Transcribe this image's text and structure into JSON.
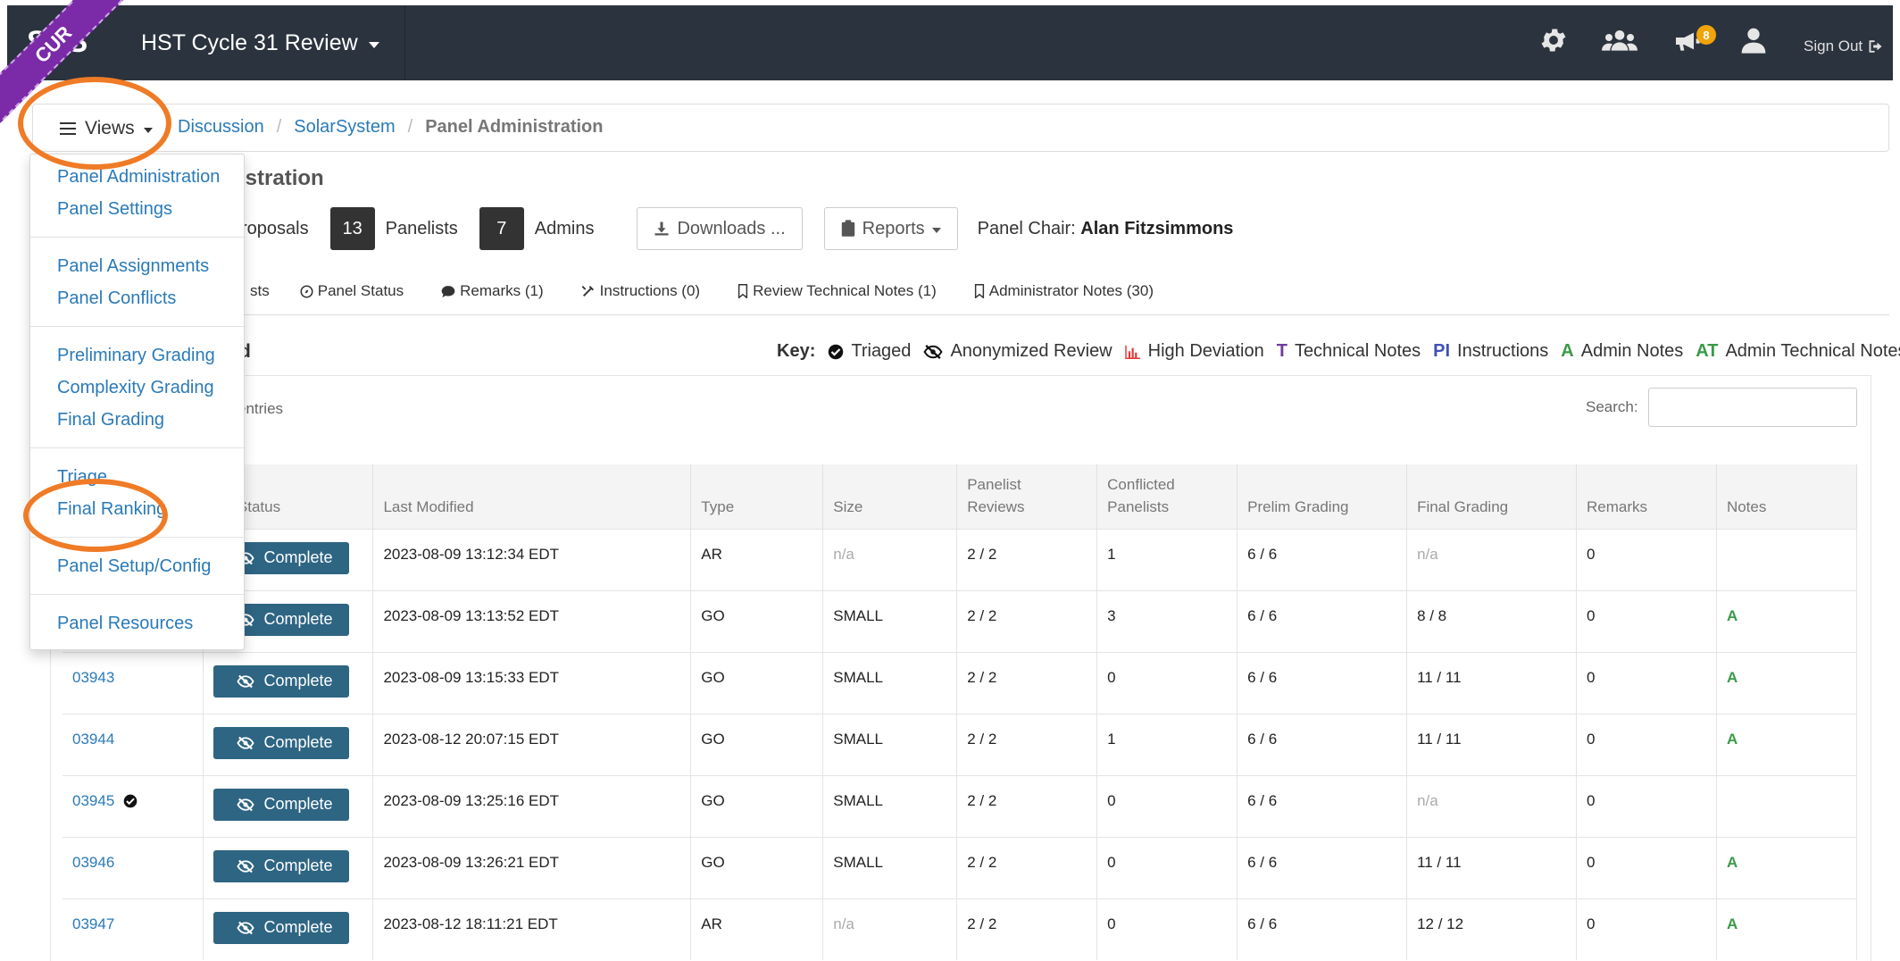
{
  "navbar": {
    "brand": "STS",
    "ribbon_text": "CUR",
    "app_title": "HST Cycle 31 Review",
    "icons": [
      "gear-icon",
      "users-icon",
      "megaphone-icon",
      "user-icon"
    ],
    "notification_count": "8",
    "sign_out_label": "Sign Out"
  },
  "breadcrumb": {
    "views_label": "Views",
    "items": [
      "Discussion",
      "SolarSystem"
    ],
    "current": "Panel Administration"
  },
  "header": {
    "title_fragment": "istration",
    "proposals_fragment": "roposals",
    "panelists_count": "13",
    "panelists_label": "Panelists",
    "admins_count": "7",
    "admins_label": "Admins",
    "downloads_label": "Downloads ...",
    "reports_label": "Reports",
    "chair_label": "Panel Chair:",
    "chair_name": "Alan Fitzsimmons"
  },
  "tabs": {
    "fragment": "sts",
    "panel_status": "Panel Status",
    "remarks": "Remarks (1)",
    "instructions": "Instructions (0)",
    "review_technical_notes": "Review Technical Notes (1)",
    "administrator_notes": "Administrator Notes (30)"
  },
  "section": {
    "title_fragment": "d",
    "entries_fragment": "entries",
    "search_label": "Search:"
  },
  "key": {
    "label": "Key:",
    "triaged": "Triaged",
    "anonymized": "Anonymized Review",
    "high_deviation": "High Deviation",
    "t_symbol": "T",
    "technical_notes": "Technical Notes",
    "pi_symbol": "PI",
    "instructions": "Instructions",
    "a_symbol": "A",
    "admin_notes": "Admin Notes",
    "at_symbol": "AT",
    "admin_technical_notes": "Admin Technical Notes"
  },
  "table": {
    "headers": {
      "review_status": "ew Status",
      "last_modified": "Last Modified",
      "type": "Type",
      "size": "Size",
      "panelist_reviews_1": "Panelist",
      "panelist_reviews_2": "Reviews",
      "conflicted_1": "Conflicted",
      "conflicted_2": "Panelists",
      "prelim": "Prelim Grading",
      "final": "Final Grading",
      "remarks": "Remarks",
      "notes": "Notes"
    },
    "rows": [
      {
        "id": "",
        "status": "Complete",
        "modified": "2023-08-09 13:12:34 EDT",
        "type": "AR",
        "size": "n/a",
        "reviews": "2  /  2",
        "conflicted": "1",
        "prelim": "6  /  6",
        "final": "n/a",
        "remarks": "0",
        "notes": ""
      },
      {
        "id": "",
        "status": "Complete",
        "modified": "2023-08-09 13:13:52 EDT",
        "type": "GO",
        "size": "SMALL",
        "reviews": "2  /  2",
        "conflicted": "3",
        "prelim": "6  /  6",
        "final": "8  /  8",
        "remarks": "0",
        "notes": "A"
      },
      {
        "id": "03943",
        "status": "Complete",
        "modified": "2023-08-09 13:15:33 EDT",
        "type": "GO",
        "size": "SMALL",
        "reviews": "2  /  2",
        "conflicted": "0",
        "prelim": "6  /  6",
        "final": "11  /  11",
        "remarks": "0",
        "notes": "A"
      },
      {
        "id": "03944",
        "status": "Complete",
        "modified": "2023-08-12 20:07:15 EDT",
        "type": "GO",
        "size": "SMALL",
        "reviews": "2  /  2",
        "conflicted": "1",
        "prelim": "6  /  6",
        "final": "11  /  11",
        "remarks": "0",
        "notes": "A"
      },
      {
        "id": "03945",
        "status": "Complete",
        "modified": "2023-08-09 13:25:16 EDT",
        "type": "GO",
        "size": "SMALL",
        "reviews": "2  /  2",
        "conflicted": "0",
        "prelim": "6  /  6",
        "final": "n/a",
        "remarks": "0",
        "notes": ""
      },
      {
        "id": "03946",
        "status": "Complete",
        "modified": "2023-08-09 13:26:21 EDT",
        "type": "GO",
        "size": "SMALL",
        "reviews": "2  /  2",
        "conflicted": "0",
        "prelim": "6  /  6",
        "final": "11  /  11",
        "remarks": "0",
        "notes": "A"
      },
      {
        "id": "03947",
        "status": "Complete",
        "modified": "2023-08-12 18:11:21 EDT",
        "type": "AR",
        "size": "n/a",
        "reviews": "2  /  2",
        "conflicted": "0",
        "prelim": "6  /  6",
        "final": "12  /  12",
        "remarks": "0",
        "notes": "A"
      }
    ]
  },
  "views_menu": {
    "items": [
      "Panel Administration",
      "Panel Settings",
      "Panel Assignments",
      "Panel Conflicts",
      "Preliminary Grading",
      "Complexity Grading",
      "Final Grading",
      "Triage",
      "Final Ranking",
      "Panel Setup/Config",
      "Panel Resources"
    ]
  },
  "colors": {
    "navbar_bg": "#2b333e",
    "ribbon": "#7b2aa8",
    "link": "#2a7ab8",
    "complete_button": "#2e6583",
    "highlight": "#f07b26",
    "admin_notes": "#3a9a48",
    "technical_notes": "#6f3ba1",
    "instructions": "#3f51b5",
    "badge": "#f0a30a"
  }
}
